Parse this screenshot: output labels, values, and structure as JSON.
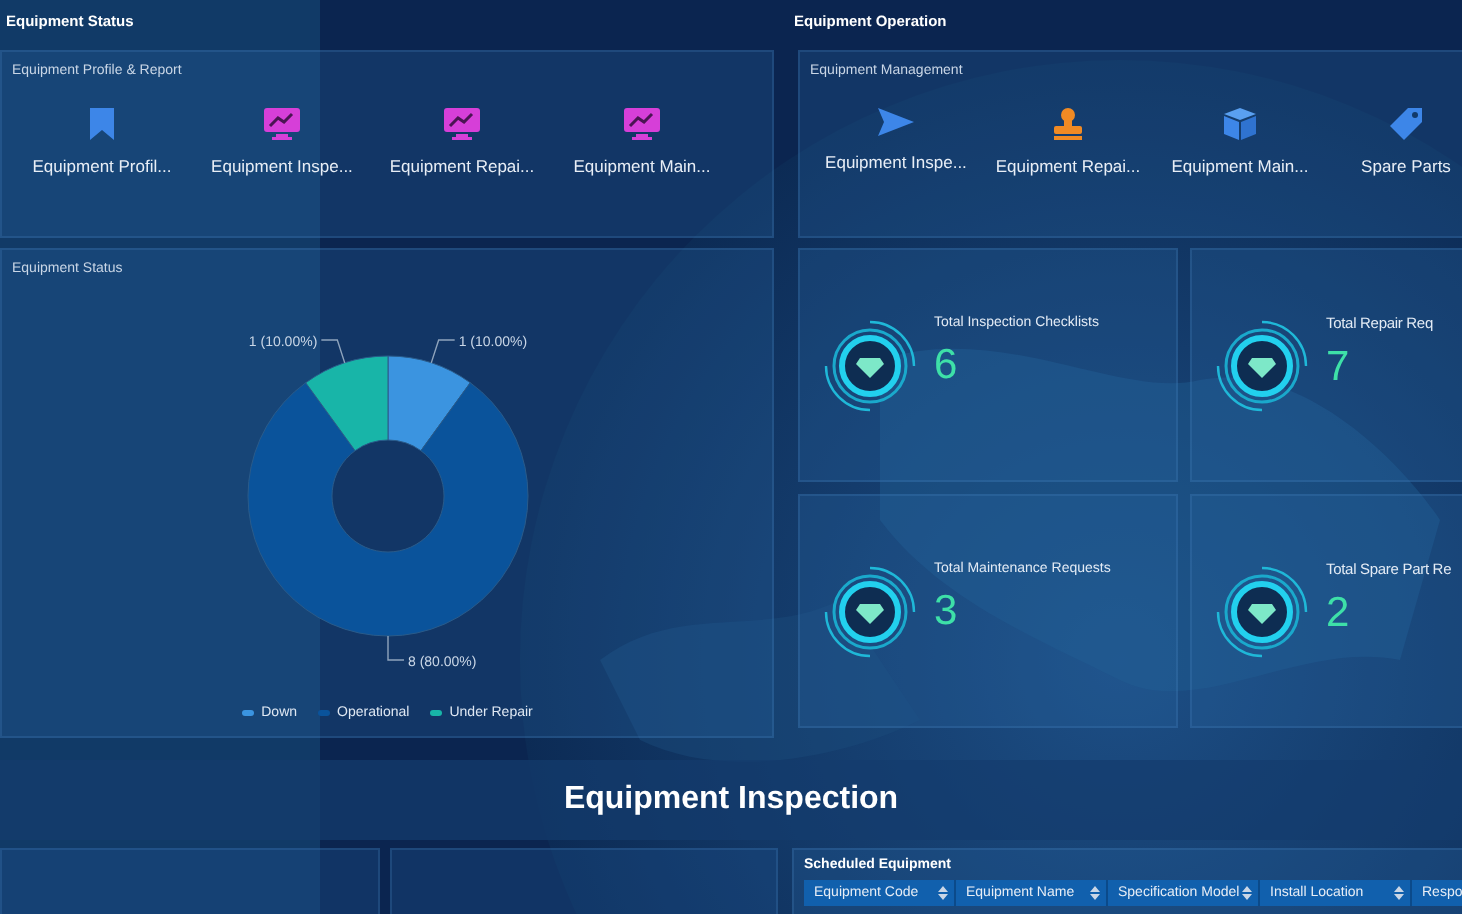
{
  "left_panel": {
    "title": "Equipment Status",
    "profile": {
      "title": "Equipment Profile & Report",
      "items": [
        {
          "label": "Equipment Profil..."
        },
        {
          "label": "Equipment Inspe..."
        },
        {
          "label": "Equipment Repai..."
        },
        {
          "label": "Equipment Main..."
        }
      ]
    },
    "status": {
      "title": "Equipment Status",
      "chart_data": {
        "type": "donut",
        "categories": [
          "Down",
          "Operational",
          "Under Repair"
        ],
        "values": [
          10,
          80,
          10
        ],
        "colors": [
          "#3b94e0",
          "#0a539b",
          "#18b5a8"
        ],
        "legend": true,
        "value_labels": [
          "1 (10.00%)",
          "8 (80.00%)",
          "1 (10.00%)"
        ]
      }
    }
  },
  "right_panel": {
    "title": "Equipment Operation",
    "management": {
      "title": "Equipment Management",
      "items": [
        {
          "label": "Equipment Inspe..."
        },
        {
          "label": "Equipment Repai..."
        },
        {
          "label": "Equipment Main..."
        },
        {
          "label": "Spare Parts"
        }
      ]
    },
    "stats": [
      {
        "label": "Total Inspection Checklists",
        "value": "6"
      },
      {
        "label": "Total Repair Req",
        "value": "7"
      },
      {
        "label": "Total Maintenance Requests",
        "value": "3"
      },
      {
        "label": "Total Spare Part Re",
        "value": "2"
      }
    ]
  },
  "banner": {
    "title": "Equipment Inspection"
  },
  "scheduled": {
    "title": "Scheduled Equipment",
    "columns": [
      "Equipment Code",
      "Equipment Name",
      "Specification Model",
      "Install Location",
      "Respo"
    ]
  }
}
